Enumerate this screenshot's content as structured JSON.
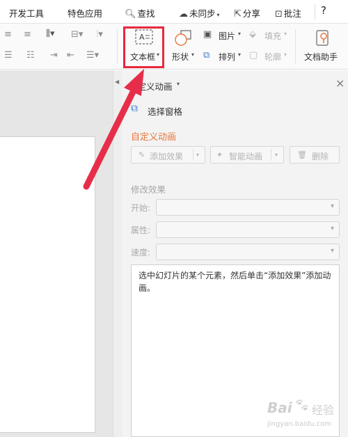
{
  "menu": {
    "dev_tools": "开发工具",
    "special_apps": "特色应用",
    "search": "查找",
    "sync": "未同步",
    "share": "分享",
    "comment": "批注",
    "help": "?"
  },
  "ribbon": {
    "textbox": "文本框",
    "shape": "形状",
    "picture": "图片",
    "fill": "填充",
    "arrange": "排列",
    "outline": "轮廓",
    "doc_assistant": "文档助手"
  },
  "pane": {
    "title": "自定义动画",
    "select_pane": "选择窗格",
    "section_title": "自定义动画",
    "add_effect": "添加效果",
    "smart_anim": "智能动画",
    "delete": "删除",
    "modify_effect": "修改效果",
    "start_label": "开始:",
    "property_label": "属性:",
    "speed_label": "速度:",
    "hint": "选中幻灯片的某个元素，然后单击“添加效果”添加动画。"
  },
  "watermark": {
    "brand": "Bai",
    "brand2": "经验",
    "url": "jingyan.baidu.com"
  },
  "colors": {
    "accent_orange": "#e8753a",
    "highlight_red": "#e8283b",
    "arrow_red": "#e62e4a"
  }
}
